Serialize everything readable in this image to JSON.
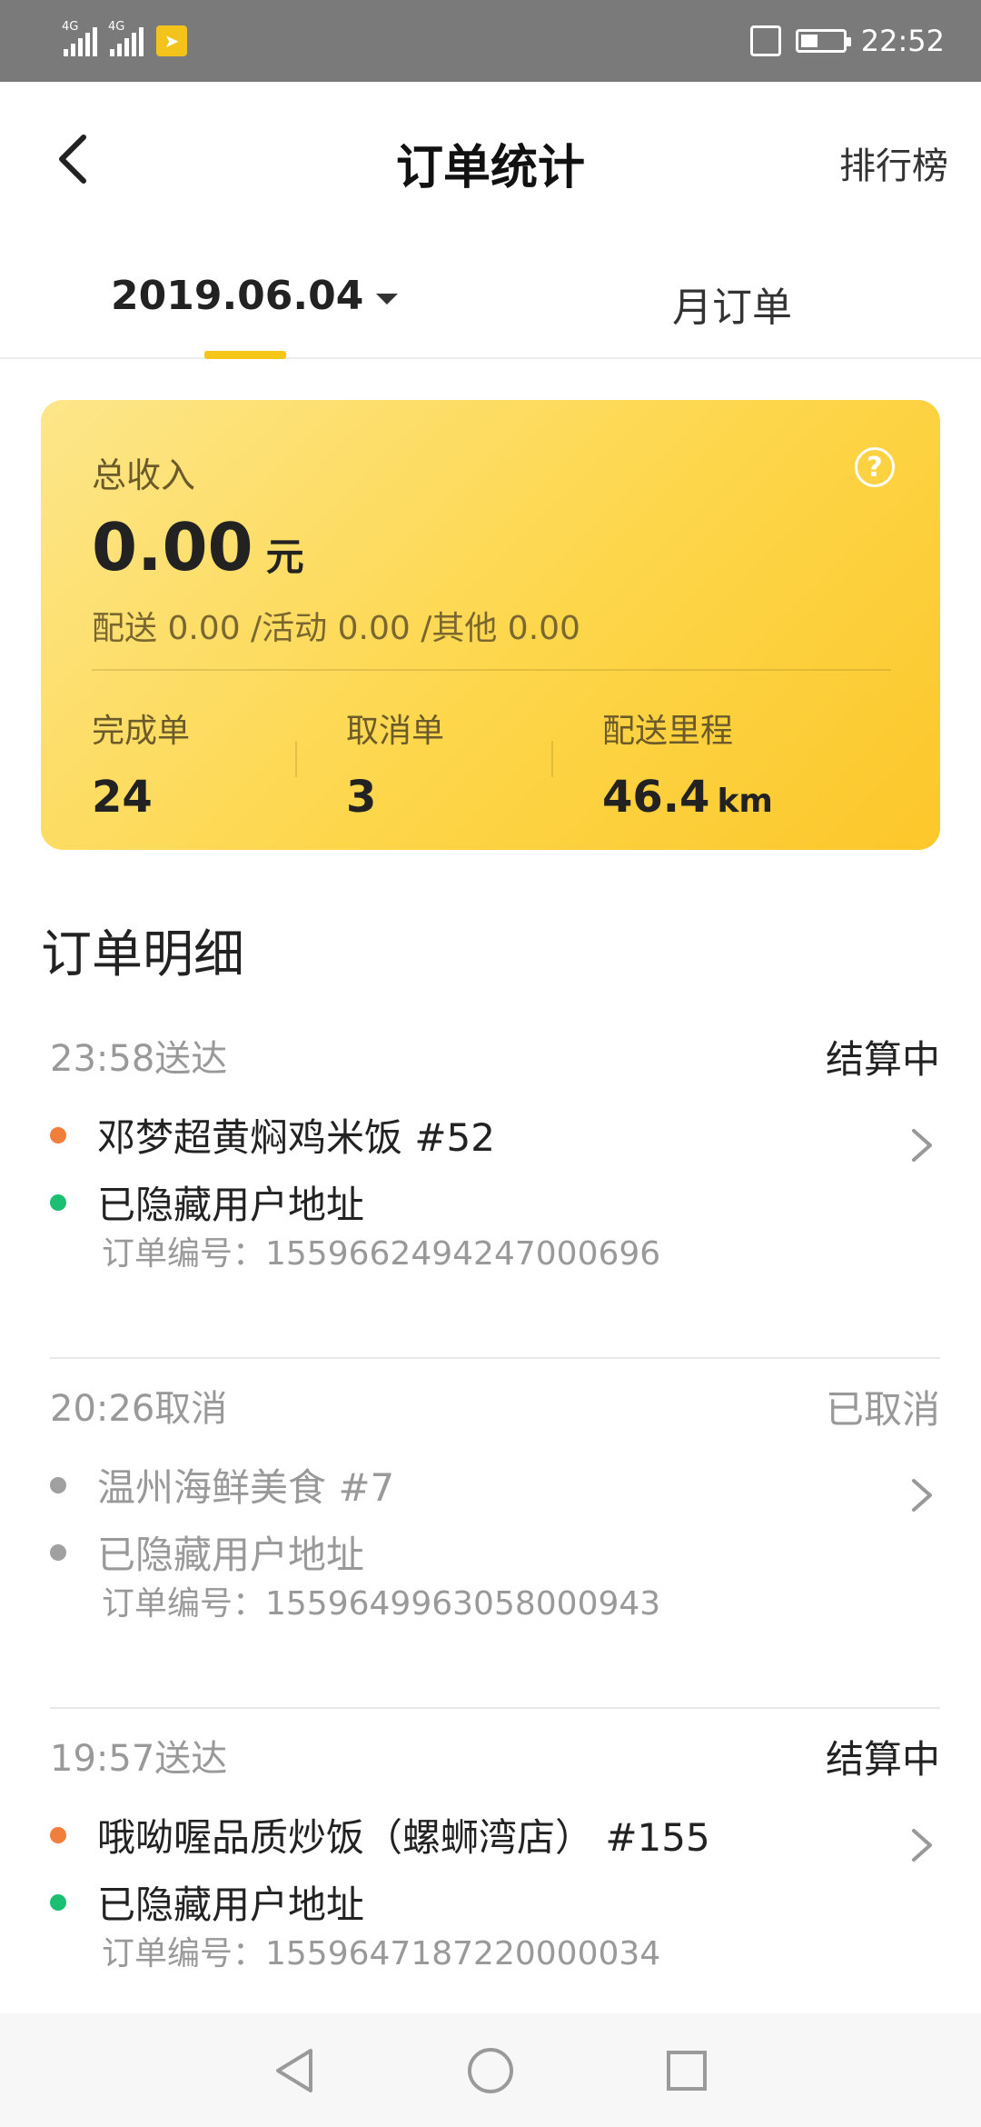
{
  "status_bar": {
    "network_1": "4G",
    "network_2": "4G",
    "time": "22:52"
  },
  "header": {
    "title": "订单统计",
    "ranking_link": "排行榜"
  },
  "tabs": {
    "date": "2019.06.04",
    "month": "月订单"
  },
  "summary": {
    "total_income_label": "总收入",
    "amount": "0.00",
    "unit": "元",
    "breakdown": "配送 0.00  /活动 0.00  /其他 0.00",
    "completed_label": "完成单",
    "completed_value": "24",
    "cancelled_label": "取消单",
    "cancelled_value": "3",
    "distance_label": "配送里程",
    "distance_value": "46.4",
    "distance_unit": "km"
  },
  "details": {
    "title": "订单明细",
    "orders": [
      {
        "time": "23:58送达",
        "status": "结算中",
        "merchant": "邓梦超黄焖鸡米饭 #52",
        "address": "已隐藏用户地址",
        "order_no": "订单编号：1559662494247000696"
      },
      {
        "time": "20:26取消",
        "status": "已取消",
        "merchant": "温州海鲜美食 #7",
        "address": "已隐藏用户地址",
        "order_no": "订单编号：1559649963058000943"
      },
      {
        "time": "19:57送达",
        "status": "结算中",
        "merchant": "哦呦喔品质炒饭（螺蛳湾店） #155",
        "address": "已隐藏用户地址",
        "order_no": "订单编号：1559647187220000034"
      }
    ]
  },
  "colors": {
    "accent": "#f5c518",
    "pickup_dot": "#f07f3c",
    "delivery_dot": "#1bbf72",
    "muted_dot": "#a0a0a0"
  }
}
